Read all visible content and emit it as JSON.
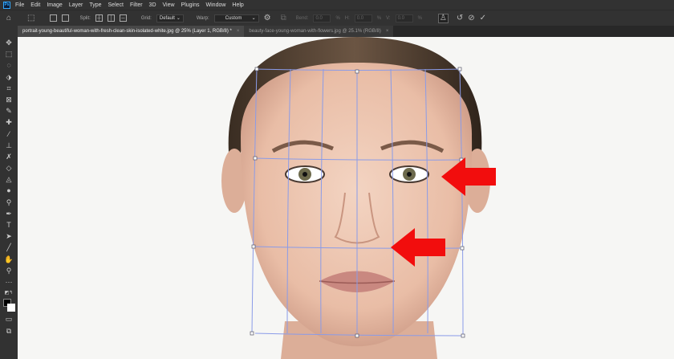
{
  "menubar": {
    "logo": "Ps",
    "items": [
      "File",
      "Edit",
      "Image",
      "Layer",
      "Type",
      "Select",
      "Filter",
      "3D",
      "View",
      "Plugins",
      "Window",
      "Help"
    ]
  },
  "options": {
    "split_label": "Split:",
    "grid_label": "Grid:",
    "grid_value": "Default",
    "warp_label": "Warp:",
    "warp_value": "Custom",
    "bend_label": "Bend:",
    "bend_value": "0.0",
    "h_label": "H:",
    "h_value": "0.0",
    "v_label": "V:",
    "v_value": "0.0",
    "percent": "%"
  },
  "tabs": [
    {
      "label": "portrait-young-beautiful-woman-with-fresh-clean-skin-isolated-white.jpg @ 25% (Layer 1, RGB/8) *",
      "active": true
    },
    {
      "label": "beauty-face-young-woman-with-flowers.jpg @ 25.1% (RGB/8)",
      "active": false
    }
  ],
  "tools": [
    "move",
    "marquee",
    "lasso",
    "object-select",
    "crop",
    "frame",
    "eyedropper",
    "healing-brush",
    "brush",
    "clone-stamp",
    "history-brush",
    "eraser",
    "paint-bucket",
    "blur",
    "dodge",
    "pen",
    "type",
    "path-select",
    "line",
    "hand",
    "zoom",
    "more",
    "swap-colors",
    "colors",
    "quick-mask",
    "screen-mode"
  ],
  "colors": {
    "arrow": "#f20d0d",
    "grid": "#8a9be8"
  }
}
